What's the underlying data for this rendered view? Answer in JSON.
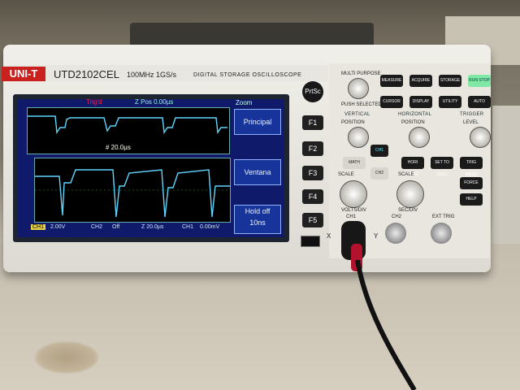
{
  "device": {
    "brand": "UNI-T",
    "model": "UTD2102CEL",
    "spec": "100MHz  1GS/s",
    "category": "DIGITAL STORAGE OSCILLOSCOPE"
  },
  "screen": {
    "trig_status": "Trig'd",
    "zpos": "Z Pos 0.00µs",
    "zoom_label": "Zoom",
    "timebase_upper": "# 20.0µs",
    "menu": [
      "Principal",
      "Ventana",
      "Hold off"
    ],
    "menu_sub": "10ns",
    "status": {
      "ch1": "2.00V",
      "ch2_label": "CH2",
      "ch2": "Off",
      "timebase": "Z 20.0µs",
      "trigger": "CH1",
      "trigger_level": "0.00mV"
    }
  },
  "buttons": {
    "prtsc": "PrtSc",
    "f_keys": [
      "F1",
      "F2",
      "F3",
      "F4",
      "F5"
    ],
    "top_row": [
      "MEASURE",
      "ACQUIRE",
      "STORAGE",
      "RUN STOP"
    ],
    "second_row": [
      "CURSOR",
      "DISPLAY",
      "UTILITY",
      "AUTO"
    ],
    "math": "MATH",
    "ch1": "CH1",
    "ch2": "CH2",
    "horiz_menu": "HORI MENU",
    "set_to_zero": "SET TO ZERO",
    "trig_menu": "TRIG MENU",
    "force": "FORCE",
    "help": "HELP",
    "multipurpose": "MULTI PURPOSE",
    "push_to_select": "PUSH SELECTED"
  },
  "sections": {
    "vertical": "VERTICAL",
    "horizontal": "HORIZONTAL",
    "trigger": "TRIGGER",
    "position_v": "POSITION",
    "position_h": "POSITION",
    "level": "LEVEL",
    "scale_v": "SCALE",
    "scale_h": "SCALE",
    "volts_div": "VOLTS/DIV",
    "sec_div": "SEC/DIV"
  },
  "connectors": {
    "ch1": "CH1",
    "ch2": "CH2",
    "ext_trig": "EXT TRIG",
    "x": "X",
    "y": "Y"
  },
  "colors": {
    "brand_red": "#c8211e",
    "screen_bg": "#101a6a",
    "trace": "#5fd6ff",
    "run_stop_green": "#7ee8a4"
  }
}
